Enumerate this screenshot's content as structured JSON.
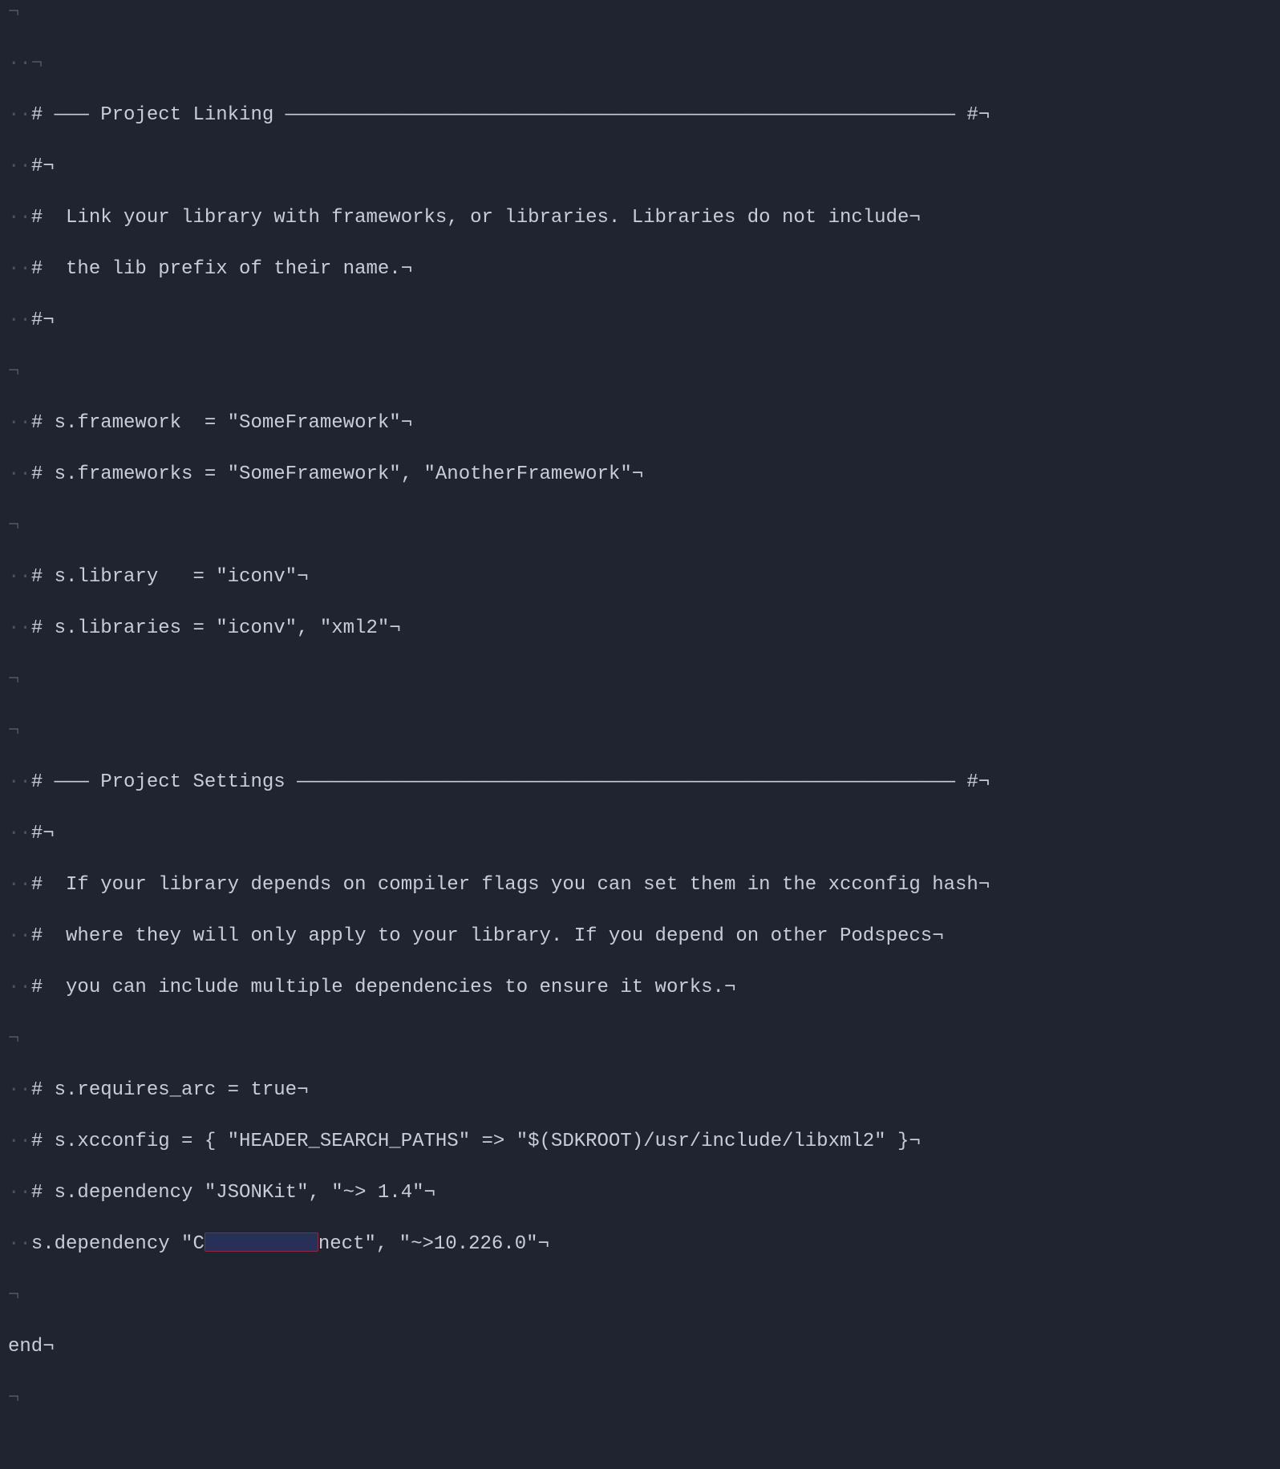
{
  "lines": {
    "l00": "¬",
    "l01_pre": "··",
    "l01_body": "¬",
    "l02_pre": "··",
    "l02_body": "# ――― Project Linking ―――――――――――――――――――――――――――――――――――――――――――――――――――――――――― #¬",
    "l03_pre": "··",
    "l03_body": "#¬",
    "l04_pre": "··",
    "l04_body": "#  Link your library with frameworks, or libraries. Libraries do not include¬",
    "l05_pre": "··",
    "l05_body": "#  the lib prefix of their name.¬",
    "l06_pre": "··",
    "l06_body": "#¬",
    "l07": "¬",
    "l08_pre": "··",
    "l08_body": "# s.framework  = \"SomeFramework\"¬",
    "l09_pre": "··",
    "l09_body": "# s.frameworks = \"SomeFramework\", \"AnotherFramework\"¬",
    "l10": "¬",
    "l11_pre": "··",
    "l11_body": "# s.library   = \"iconv\"¬",
    "l12_pre": "··",
    "l12_body": "# s.libraries = \"iconv\", \"xml2\"¬",
    "l13": "¬",
    "l14": "¬",
    "l15_pre": "··",
    "l15_body": "# ――― Project Settings ――――――――――――――――――――――――――――――――――――――――――――――――――――――――― #¬",
    "l16_pre": "··",
    "l16_body": "#¬",
    "l17_pre": "··",
    "l17_body": "#  If your library depends on compiler flags you can set them in the xcconfig hash¬",
    "l18_pre": "··",
    "l18_body": "#  where they will only apply to your library. If you depend on other Podspecs¬",
    "l19_pre": "··",
    "l19_body": "#  you can include multiple dependencies to ensure it works.¬",
    "l20": "¬",
    "l21_pre": "··",
    "l21_body": "# s.requires_arc = true¬",
    "l22_pre": "··",
    "l22_body": "# s.xcconfig = { \"HEADER_SEARCH_PATHS\" => \"$(SDKROOT)/usr/include/libxml2\" }¬",
    "l23_pre": "··",
    "l23_body": "# s.dependency \"JSONKit\", \"~> 1.4\"¬",
    "l24_pre": "··",
    "l24_a": "s.dependency \"C",
    "l24_b": "nect\", \"~>10.226.0\"¬",
    "l25": "¬",
    "l26": "end¬",
    "l27": "¬"
  }
}
